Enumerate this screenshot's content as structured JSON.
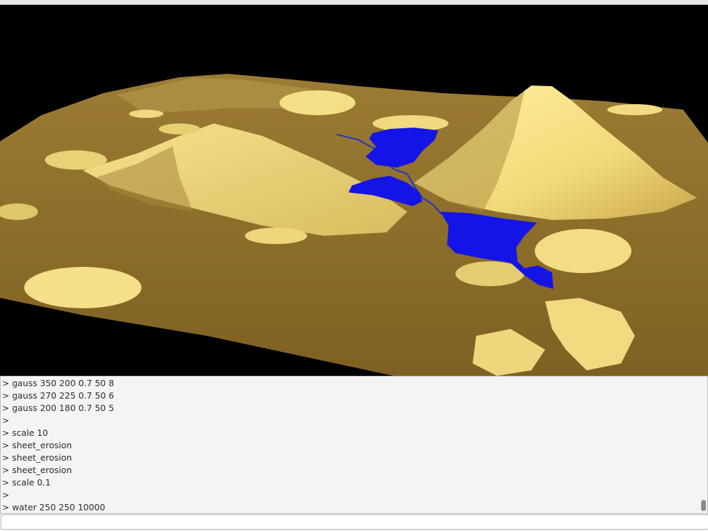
{
  "viewport": {
    "scene": "3d-terrain-render",
    "colors": {
      "background": "#000000",
      "terrain_dark": "#8a6620",
      "terrain_mid": "#a88a3e",
      "terrain_light": "#f5e08a",
      "water": "#1414e6"
    }
  },
  "console": {
    "lines": [
      "> gauss 350 200 0.7 50 8",
      "> gauss 270 225 0.7 50 6",
      "> gauss 200 180 0.7 50 5",
      ">",
      "> scale 10",
      "> sheet_erosion",
      "> sheet_erosion",
      "> sheet_erosion",
      "> scale 0.1",
      ">",
      "> water 250 250 10000"
    ]
  },
  "command": {
    "value": ""
  }
}
